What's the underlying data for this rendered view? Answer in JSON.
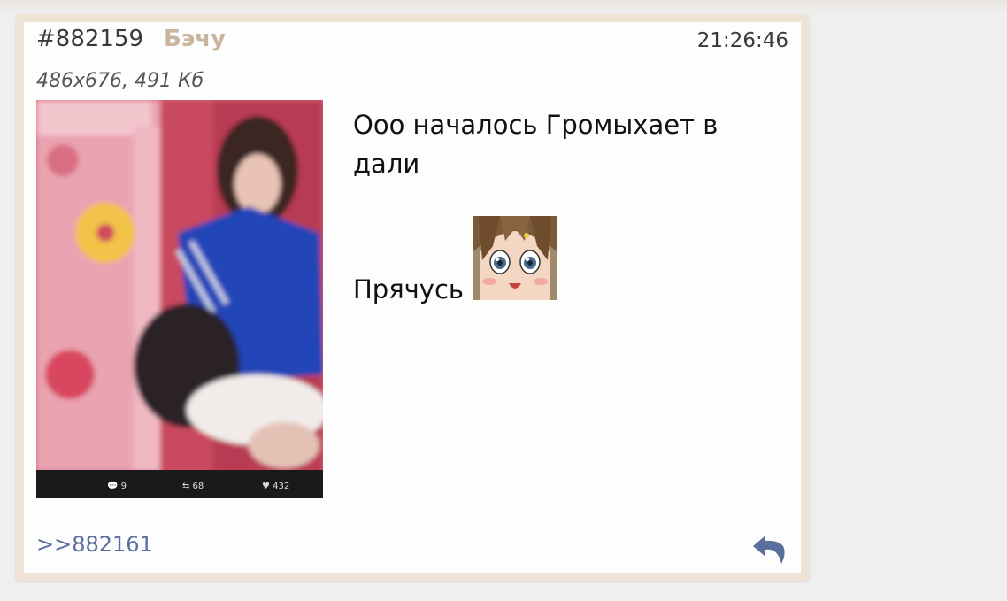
{
  "post": {
    "number": "#882159",
    "name": "Бэчу",
    "time": "21:26:46",
    "file_info": "486x676, 491 Кб",
    "message_line1": "Ооо началось Громыхает в дали",
    "message_line2": "Прячусь",
    "reply_link": ">>882161",
    "attachment_stats": {
      "comments": "9",
      "retweets": "68",
      "likes": "432"
    }
  },
  "icons": {
    "reply": "reply-arrow-icon",
    "sticker": "anime-face-sticker-icon"
  },
  "colors": {
    "name": "#c9b59d",
    "link": "#5a6f9c",
    "post_border": "#efe3d5"
  }
}
